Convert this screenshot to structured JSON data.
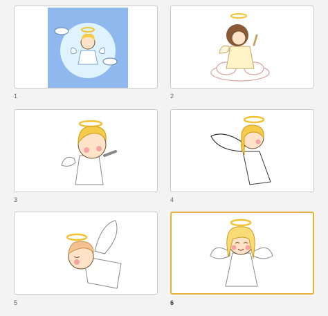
{
  "slides": [
    {
      "number": "1",
      "thumbnail": "angel-on-moon-icon",
      "selected": false
    },
    {
      "number": "2",
      "thumbnail": "angel-on-cloud-icon",
      "selected": false
    },
    {
      "number": "3",
      "thumbnail": "blonde-angel-icon",
      "selected": false
    },
    {
      "number": "4",
      "thumbnail": "flying-angel-icon",
      "selected": false
    },
    {
      "number": "5",
      "thumbnail": "sleeping-angel-icon",
      "selected": false
    },
    {
      "number": "6",
      "thumbnail": "smiling-angel-icon",
      "selected": true
    }
  ],
  "colors": {
    "selected_border": "#e3b23c",
    "slide1_background": "#8fb9ee"
  }
}
